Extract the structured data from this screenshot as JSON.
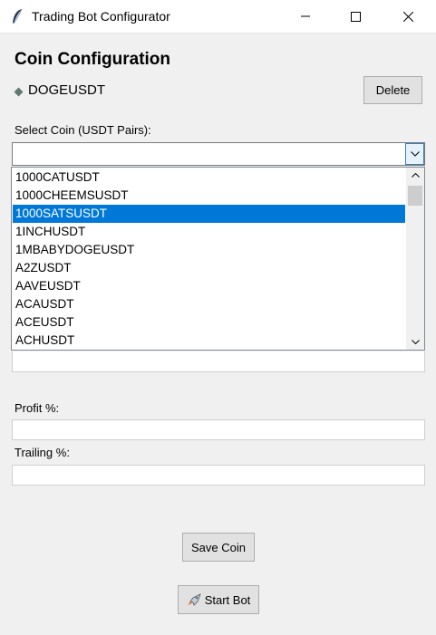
{
  "window": {
    "title": "Trading Bot Configurator",
    "app_icon": "feather-icon"
  },
  "header": {
    "heading": "Coin Configuration",
    "current_coin": "DOGEUSDT",
    "delete_label": "Delete"
  },
  "coin_select": {
    "label": "Select Coin (USDT Pairs):",
    "value": "",
    "options": [
      "1000CATUSDT",
      "1000CHEEMSUSDT",
      "1000SATSUSDT",
      "1INCHUSDT",
      "1MBABYDOGEUSDT",
      "A2ZUSDT",
      "AAVEUSDT",
      "ACAUSDT",
      "ACEUSDT",
      "ACHUSDT"
    ],
    "selected_index": 2
  },
  "coin_entry": {
    "value": ""
  },
  "profit": {
    "label": "Profit %:",
    "value": ""
  },
  "trailing": {
    "label": "Trailing %:",
    "value": ""
  },
  "actions": {
    "save_label": "Save Coin",
    "start_label": "Start Bot",
    "start_icon": "rocket-icon"
  },
  "colors": {
    "selection": "#0078d7",
    "background": "#f0f0f0",
    "button": "#e1e1e1"
  }
}
